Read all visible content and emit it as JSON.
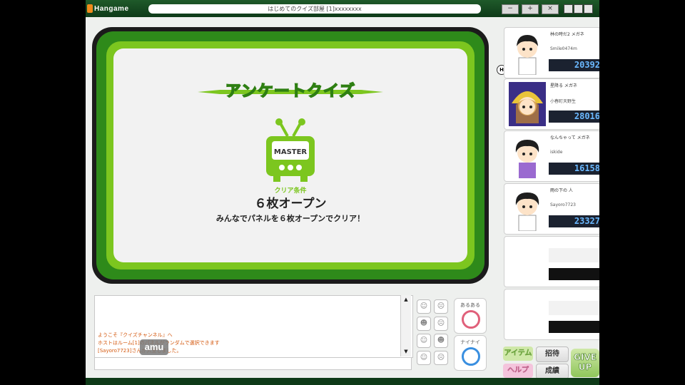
{
  "app": {
    "brand": "Hangame",
    "window_title": "はじめてのクイズ部屋  [1]xxxxxxxx",
    "controls": {
      "minimize": "−",
      "maximize": "+",
      "close": "×"
    }
  },
  "quiz": {
    "banner": "アンケートクイズ",
    "tv_label": "MASTER",
    "clear_condition_label": "クリア条件",
    "clear_condition": "６枚オープン",
    "clear_description": "みんなでパネルを６枚オープンでクリア！"
  },
  "players": [
    {
      "name": "林の時だ2 メガネ",
      "id": "Smile0474m",
      "score": "20392"
    },
    {
      "name": "星降る メガネ",
      "id": "小春町天野生",
      "score": "28016"
    },
    {
      "name": "なんちゃって メガネ",
      "id": "iskide",
      "score": "16158"
    },
    {
      "name": "雨の下の 人",
      "id": "Sayoro7723",
      "score": "23327"
    }
  ],
  "host_badge": "H",
  "chat": {
    "lines": [
      "ようこそ『クイズチャンネル』へ",
      "ホストはルーム[1]のパネルがランダムで選択できます",
      "[Sayoro7723]さんが入室しました。"
    ]
  },
  "watermark": "amu",
  "reactions": {
    "aruaru": "あるある",
    "naiai": "ナイナイ"
  },
  "buttons": {
    "item": "アイテム",
    "invite": "招待",
    "help": "ヘルプ",
    "results": "成績",
    "giveup_line1": "GIVE",
    "giveup_line2": "UP"
  },
  "emoticons": [
    "☺",
    "☹",
    "☻",
    "☹",
    "☺",
    "☻",
    "☺",
    "☹"
  ],
  "colors": {
    "accent_green": "#7cc61f",
    "dark_green": "#2e8a1a",
    "score_blue": "#6ab8ff",
    "chat_orange": "#d4580e",
    "aruaru_ring": "#e0607a",
    "naiai_ring": "#3a8fe0"
  }
}
